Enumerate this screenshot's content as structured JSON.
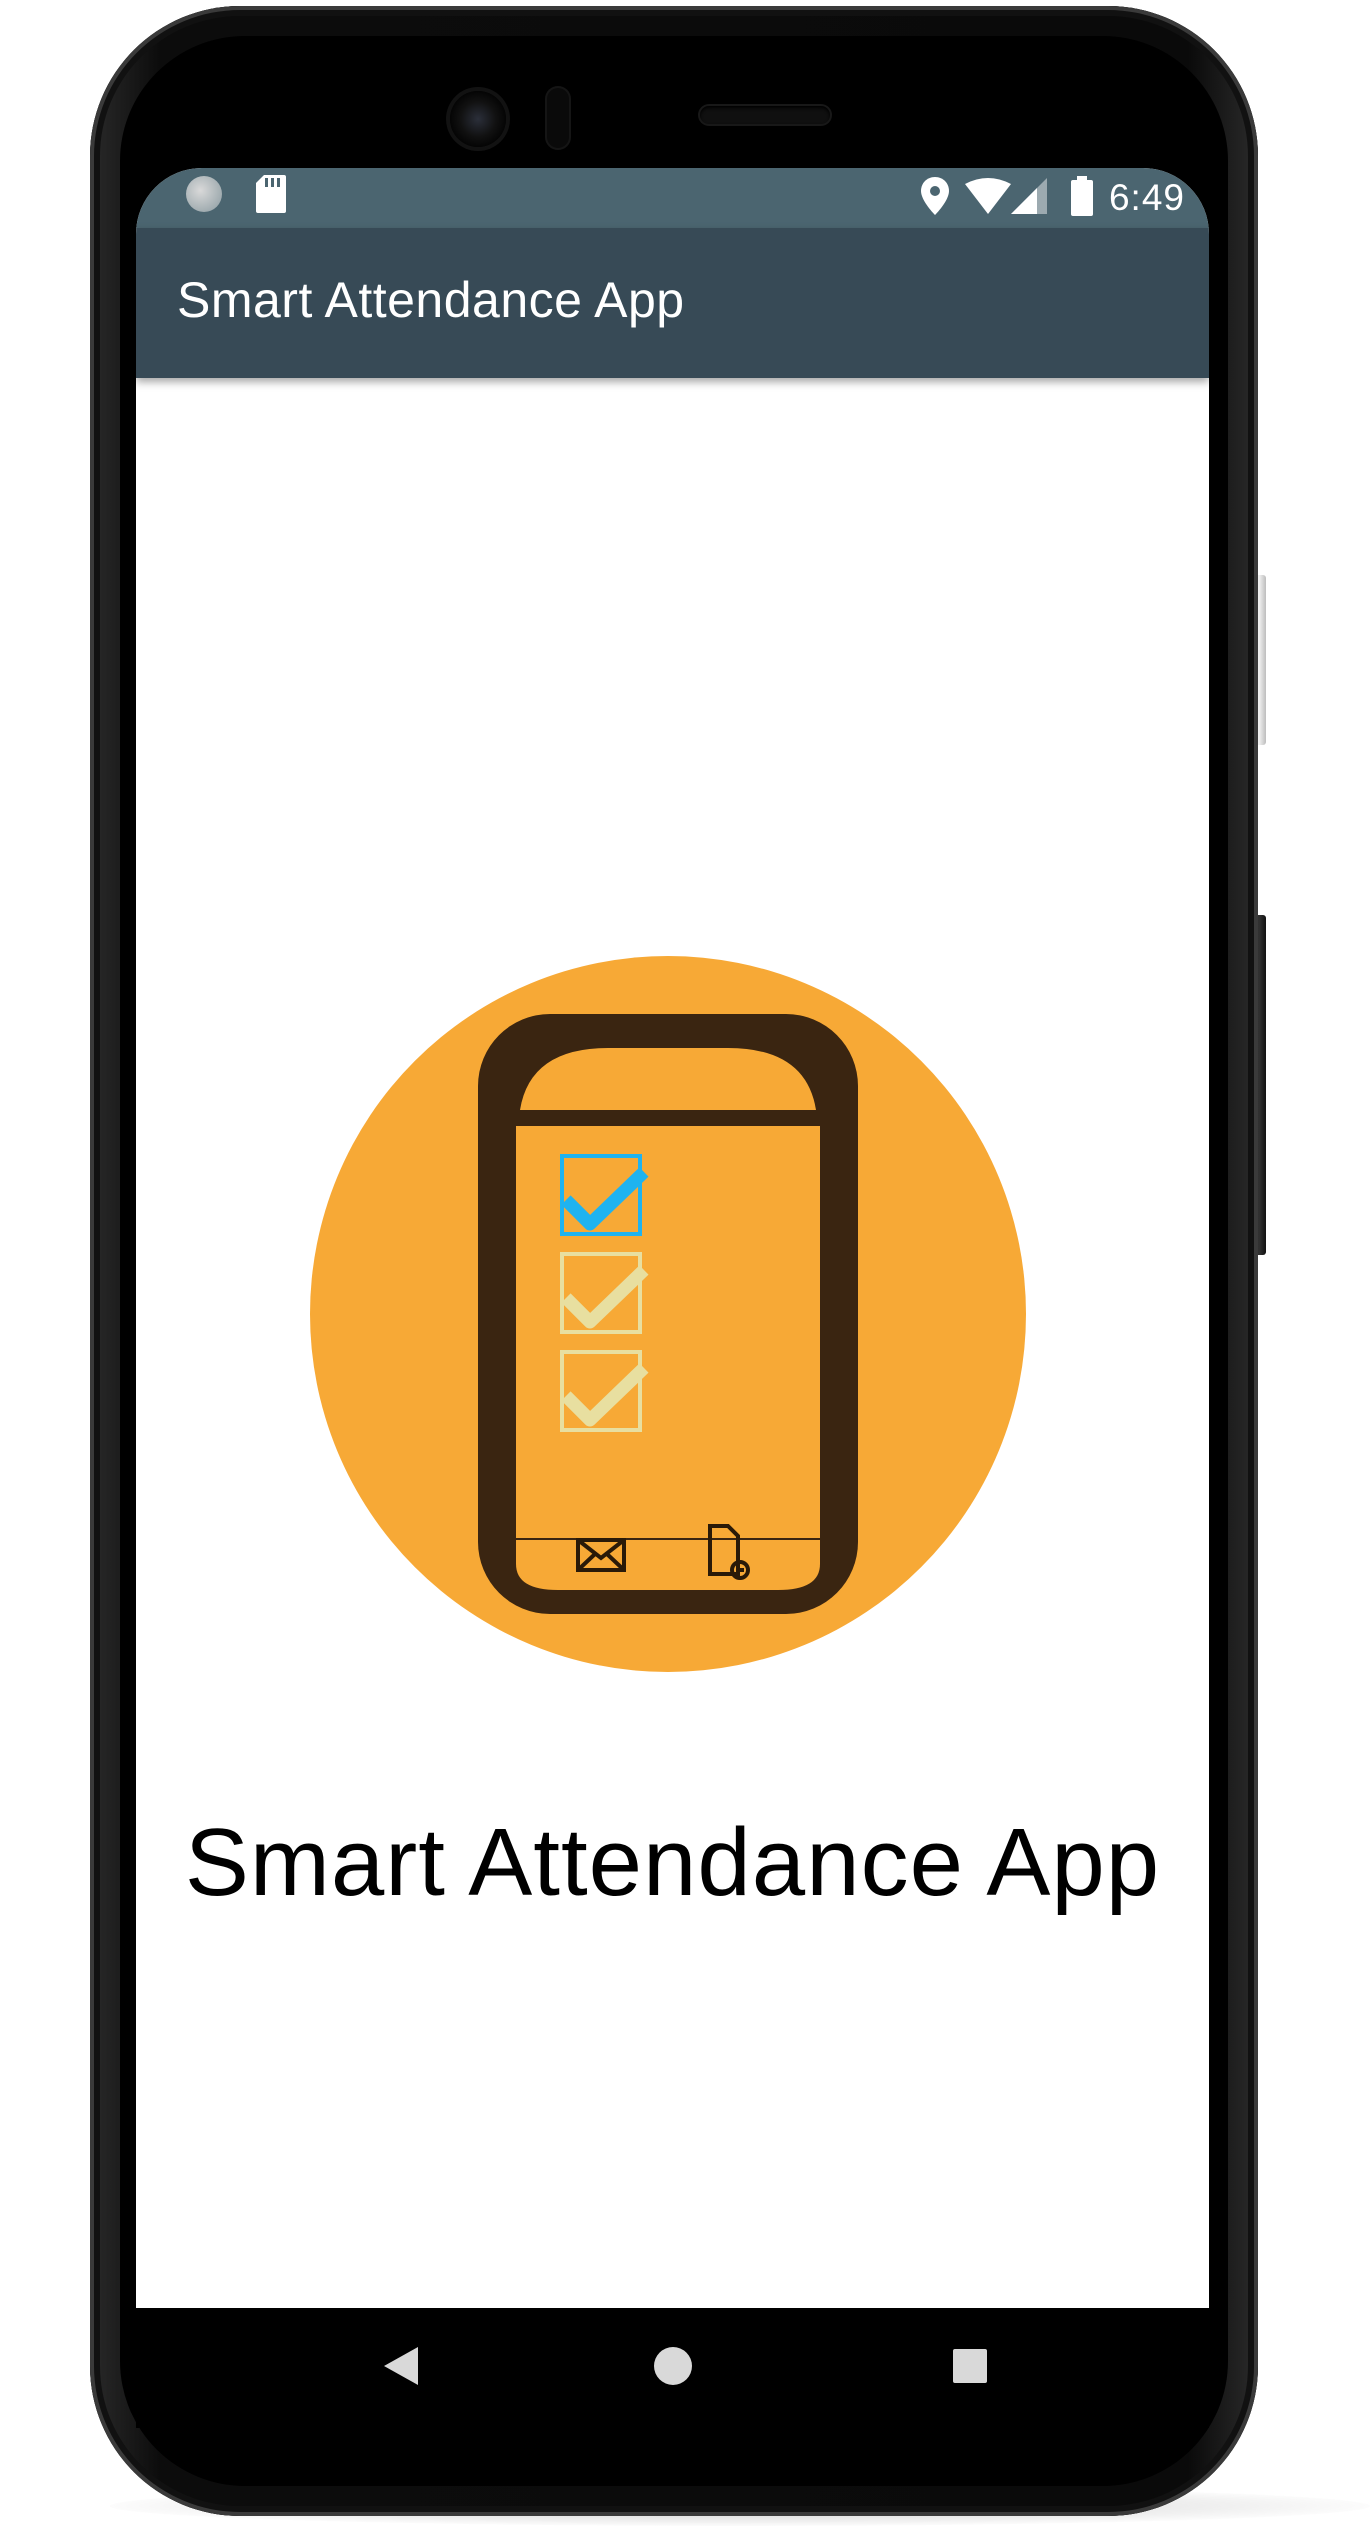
{
  "status_bar": {
    "time": "6:49",
    "left_icons": [
      "sync-icon",
      "sd-card-icon"
    ],
    "right_icons": [
      "location-icon",
      "wifi-icon",
      "signal-icon",
      "battery-icon"
    ]
  },
  "app_bar": {
    "title": "Smart Attendance App"
  },
  "main": {
    "logo_icon": "attendance-phone-logo",
    "title": "Smart Attendance App"
  },
  "nav_bar": {
    "buttons": [
      "back-icon",
      "home-icon",
      "recents-icon"
    ]
  },
  "colors": {
    "status_bar": "#4b6570",
    "app_bar": "#374a56",
    "logo_circle": "#f7a936",
    "logo_phone": "#3a2511",
    "check_active": "#1fb3f0",
    "check_inactive": "#e8dfa0"
  }
}
